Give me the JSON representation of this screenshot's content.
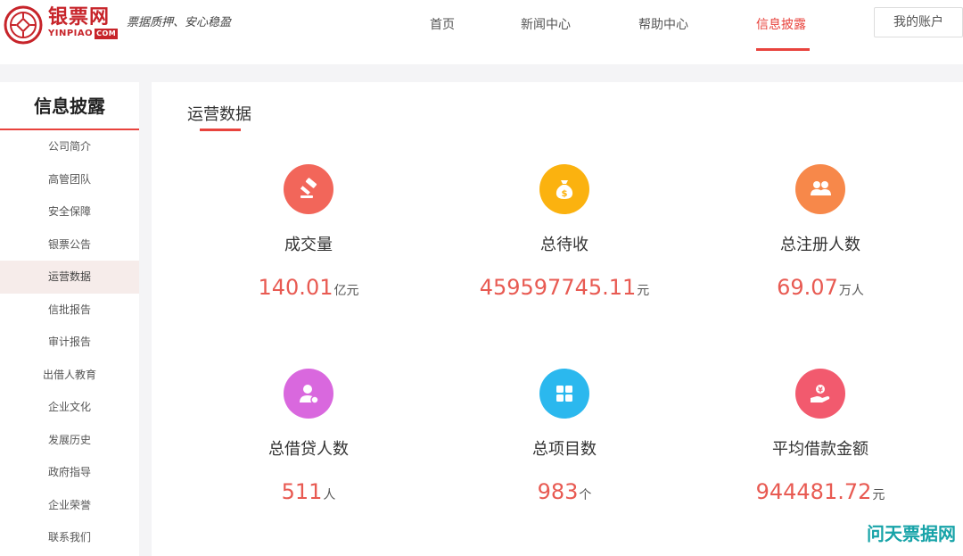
{
  "header": {
    "brand_name": "银票网",
    "brand_en": "YINPIAO",
    "brand_com": "COM",
    "slogan": "票据质押、安心稳盈",
    "nav": [
      {
        "label": "首页",
        "active": false
      },
      {
        "label": "新闻中心",
        "active": false
      },
      {
        "label": "帮助中心",
        "active": false
      },
      {
        "label": "信息披露",
        "active": true
      }
    ],
    "account_label": "我的账户",
    "accent": "#e8433d",
    "brand_color": "#c7242a"
  },
  "sidebar": {
    "title": "信息披露",
    "items": [
      {
        "label": "公司简介",
        "active": false
      },
      {
        "label": "高管团队",
        "active": false
      },
      {
        "label": "安全保障",
        "active": false
      },
      {
        "label": "银票公告",
        "active": false
      },
      {
        "label": "运营数据",
        "active": true
      },
      {
        "label": "信批报告",
        "active": false
      },
      {
        "label": "审计报告",
        "active": false
      },
      {
        "label": "出借人教育",
        "active": false
      },
      {
        "label": "企业文化",
        "active": false
      },
      {
        "label": "发展历史",
        "active": false
      },
      {
        "label": "政府指导",
        "active": false
      },
      {
        "label": "企业荣誉",
        "active": false
      },
      {
        "label": "联系我们",
        "active": false
      }
    ]
  },
  "main": {
    "section_title": "运营数据",
    "stats": [
      {
        "label": "成交量",
        "value": "140.01",
        "unit": "亿元",
        "icon": "gavel-icon",
        "color": "#f2665a"
      },
      {
        "label": "总待收",
        "value": "459597745.11",
        "unit": "元",
        "icon": "money-bag-icon",
        "color": "#fbb20f"
      },
      {
        "label": "总注册人数",
        "value": "69.07",
        "unit": "万人",
        "icon": "users-icon",
        "color": "#f7884a"
      },
      {
        "label": "总借贷人数",
        "value": "511",
        "unit": "人",
        "icon": "user-badge-icon",
        "color": "#d968de"
      },
      {
        "label": "总项目数",
        "value": "983",
        "unit": "个",
        "icon": "grid-icon",
        "color": "#2bb8ee"
      },
      {
        "label": "平均借款金额",
        "value": "944481.72",
        "unit": "元",
        "icon": "hand-coin-icon",
        "color": "#f25a6e"
      }
    ]
  },
  "watermark": "问天票据网"
}
